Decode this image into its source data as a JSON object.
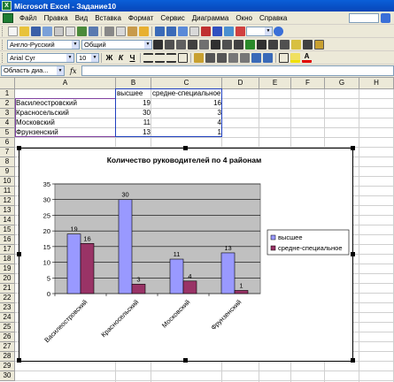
{
  "window": {
    "title": "Microsoft Excel - Задание10",
    "icon": "excel-icon"
  },
  "menu": {
    "items": [
      "Файл",
      "Правка",
      "Вид",
      "Вставка",
      "Формат",
      "Сервис",
      "Диаграмма",
      "Окно",
      "Справка"
    ]
  },
  "toolbar2": {
    "language": "Англо-Русский",
    "style": "Общий"
  },
  "toolbar3": {
    "font": "Arial Cyr",
    "size": "10",
    "bold": "Ж",
    "italic": "К",
    "underline": "Ч"
  },
  "formula": {
    "name_box": "Область диа...",
    "fx": "fx"
  },
  "sheet": {
    "columns": [
      "A",
      "B",
      "C",
      "D",
      "E",
      "F",
      "G",
      "H"
    ],
    "rows": [
      "1",
      "2",
      "3",
      "4",
      "5",
      "6",
      "7",
      "8",
      "9",
      "10",
      "11",
      "12",
      "13",
      "14",
      "15",
      "16",
      "17",
      "18",
      "19",
      "20",
      "21",
      "22",
      "23",
      "24",
      "25",
      "26",
      "27",
      "28",
      "29",
      "30"
    ],
    "header": {
      "b1": "высшее",
      "c1": "средне-специальное"
    },
    "data": [
      {
        "district": "Василеостровский",
        "higher": "19",
        "special": "16"
      },
      {
        "district": "Красносельский",
        "higher": "30",
        "special": "3"
      },
      {
        "district": "Московский",
        "higher": "11",
        "special": "4"
      },
      {
        "district": "Фрунзенский",
        "higher": "13",
        "special": "1"
      }
    ]
  },
  "chart_data": {
    "type": "bar",
    "title": "Количество руководителей по 4 районам",
    "categories": [
      "Василеостровский",
      "Красносельский",
      "Московский",
      "Фрунзенский"
    ],
    "series": [
      {
        "name": "высшее",
        "values": [
          19,
          30,
          11,
          13
        ],
        "color": "#9999ff"
      },
      {
        "name": "средне-специальное",
        "values": [
          16,
          3,
          4,
          1
        ],
        "color": "#993366"
      }
    ],
    "ylim": [
      0,
      35
    ],
    "yticks": [
      0,
      5,
      10,
      15,
      20,
      25,
      30,
      35
    ],
    "grid": true,
    "plot_background": "#c0c0c0",
    "legend": "right"
  }
}
